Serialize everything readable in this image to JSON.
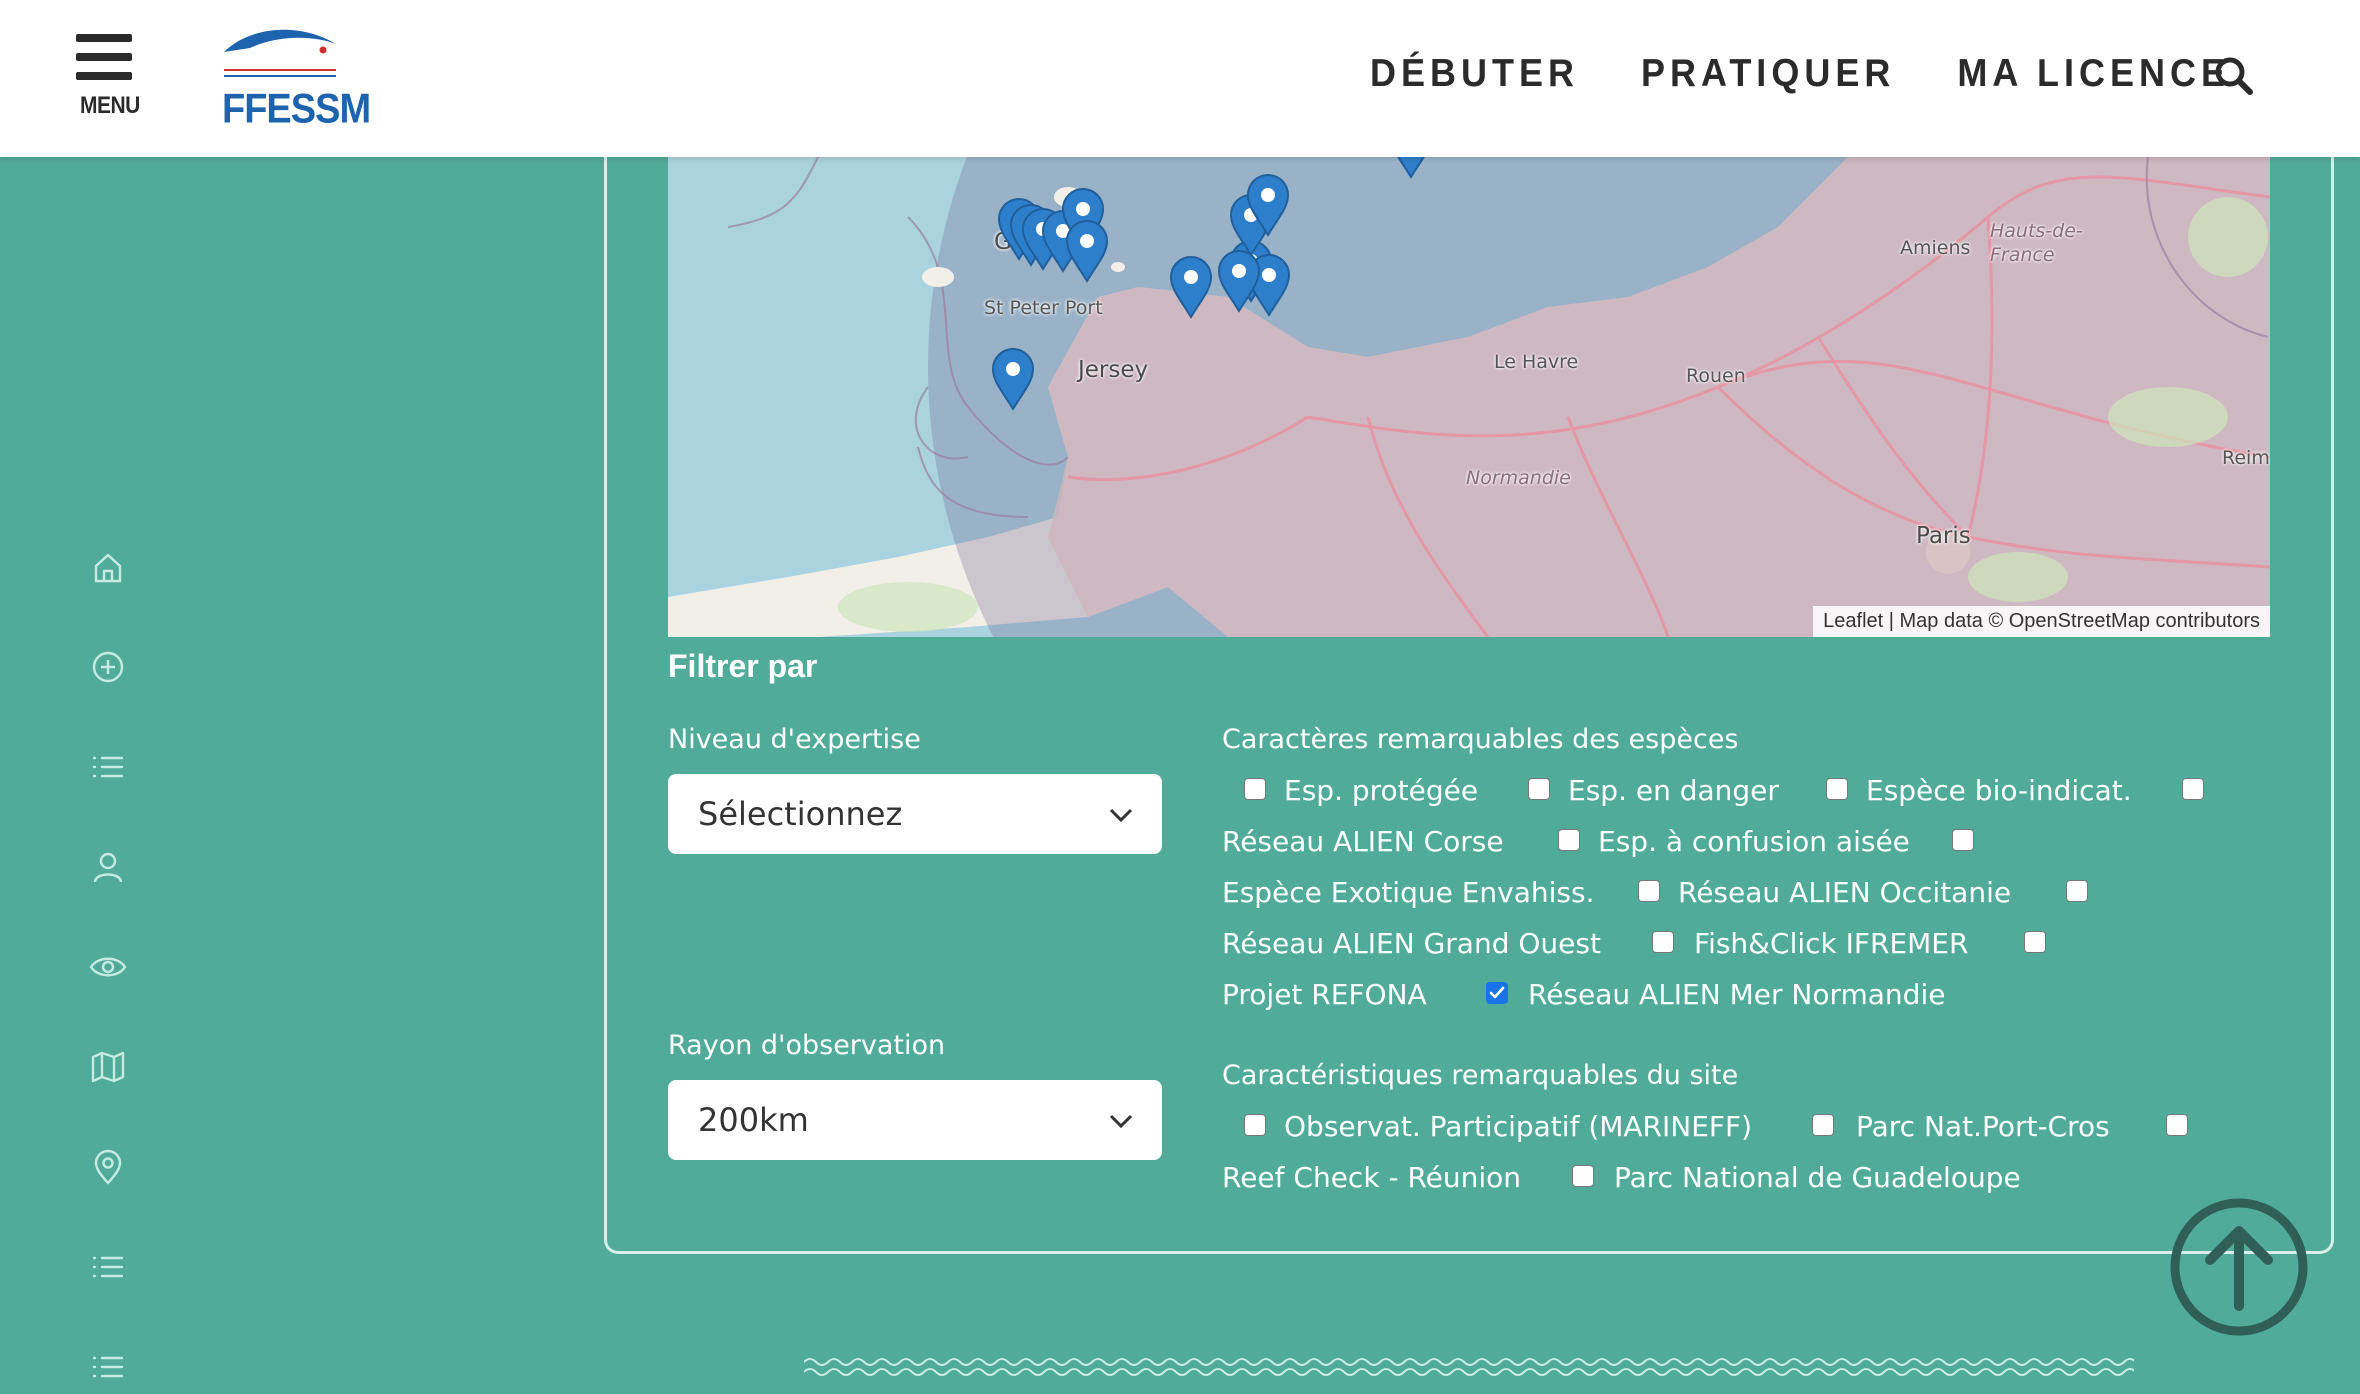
{
  "header": {
    "menu_label": "MENU",
    "logo_text": "FFESSM",
    "nav": [
      "DÉBUTER",
      "PRATIQUER",
      "MA LICENCE"
    ],
    "search_icon": "search-icon"
  },
  "sidebar": {
    "icons": [
      "home-icon",
      "plus-circle-icon",
      "list-icon",
      "user-icon",
      "eye-icon",
      "map-icon",
      "location-pin-icon",
      "list-icon",
      "list-icon"
    ]
  },
  "map": {
    "places": {
      "guernsey": "Guernsey",
      "st_peter_port": "St Peter Port",
      "jersey": "Jersey",
      "amiens": "Amiens",
      "hauts_de_france": "Hauts-de-\nFrance",
      "rouen": "Rouen",
      "le_havre": "Le Havre",
      "normandie": "Normandie",
      "paris": "Paris",
      "reims": "Reim"
    },
    "attribution_leaflet": "Leaflet",
    "attribution_rest": " | Map data © OpenStreetMap contributors",
    "colors": {
      "sea": "#aad3df",
      "land": "#f2efe9",
      "circle": "rgba(120,110,150,0.35)",
      "pin": "#2e7fcb"
    }
  },
  "filters": {
    "title": "Filtrer par",
    "expertise": {
      "label": "Niveau d'expertise",
      "value": "Sélectionnez"
    },
    "radius": {
      "label": "Rayon d'observation",
      "value": "200km"
    },
    "species": {
      "label": "Caractères remarquables des espèces",
      "options": [
        {
          "text": "Esp. protégée",
          "checked": false
        },
        {
          "text": "Esp. en danger",
          "checked": false
        },
        {
          "text": "Espèce bio-indicat.",
          "checked": false
        },
        {
          "text": "Réseau ALIEN Corse",
          "checked": false
        },
        {
          "text": "Esp. à confusion aisée",
          "checked": false
        },
        {
          "text": "Espèce Exotique Envahiss.",
          "checked": false
        },
        {
          "text": "Réseau ALIEN Occitanie",
          "checked": false
        },
        {
          "text": "Réseau ALIEN Grand Ouest",
          "checked": false
        },
        {
          "text": "Fish&Click IFREMER",
          "checked": false
        },
        {
          "text": "Projet REFONA",
          "checked": false
        },
        {
          "text": "Réseau ALIEN Mer Normandie",
          "checked": true
        }
      ]
    },
    "site": {
      "label": "Caractéristiques remarquables du site",
      "options": [
        {
          "text": "Observat. Participatif (MARINEFF)",
          "checked": false
        },
        {
          "text": "Parc Nat.Port-Cros",
          "checked": false
        },
        {
          "text": "Reef Check - Réunion",
          "checked": false
        },
        {
          "text": "Parc National de Guadeloupe",
          "checked": false
        }
      ]
    }
  },
  "scroll_top_icon": "arrow-up-circle-icon"
}
